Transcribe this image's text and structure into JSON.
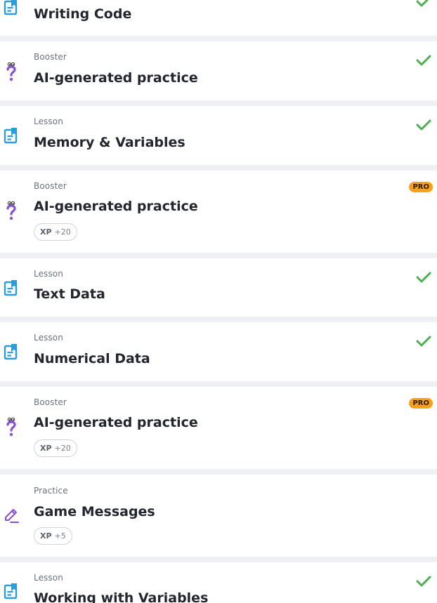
{
  "colors": {
    "lesson_icon": "#2d9cdb",
    "booster_icon": "#8a4fd8",
    "practice_icon": "#8a4fd8",
    "check": "#4caf50",
    "pro_badge": "#f7a01b",
    "divider": "#eef0f4"
  },
  "items": [
    {
      "type": "",
      "title": "Writing Code",
      "icon": "lesson-icon",
      "completed": true
    },
    {
      "type": "Booster",
      "title": "AI-generated practice",
      "icon": "booster-question-icon",
      "completed": true
    },
    {
      "type": "Lesson",
      "title": "Memory & Variables",
      "icon": "lesson-icon",
      "completed": true
    },
    {
      "type": "Booster",
      "title": "AI-generated practice",
      "icon": "booster-question-icon",
      "pro": "PRO",
      "xp_label": "XP",
      "xp_value": "+20"
    },
    {
      "type": "Lesson",
      "title": "Text Data",
      "icon": "lesson-icon",
      "completed": true
    },
    {
      "type": "Lesson",
      "title": "Numerical Data",
      "icon": "lesson-icon",
      "completed": true
    },
    {
      "type": "Booster",
      "title": "AI-generated practice",
      "icon": "booster-question-icon",
      "pro": "PRO",
      "xp_label": "XP",
      "xp_value": "+20"
    },
    {
      "type": "Practice",
      "title": "Game Messages",
      "icon": "practice-pencil-icon",
      "xp_label": "XP",
      "xp_value": "+5"
    },
    {
      "type": "Lesson",
      "title": "Working with Variables",
      "icon": "lesson-icon",
      "completed": true
    }
  ]
}
